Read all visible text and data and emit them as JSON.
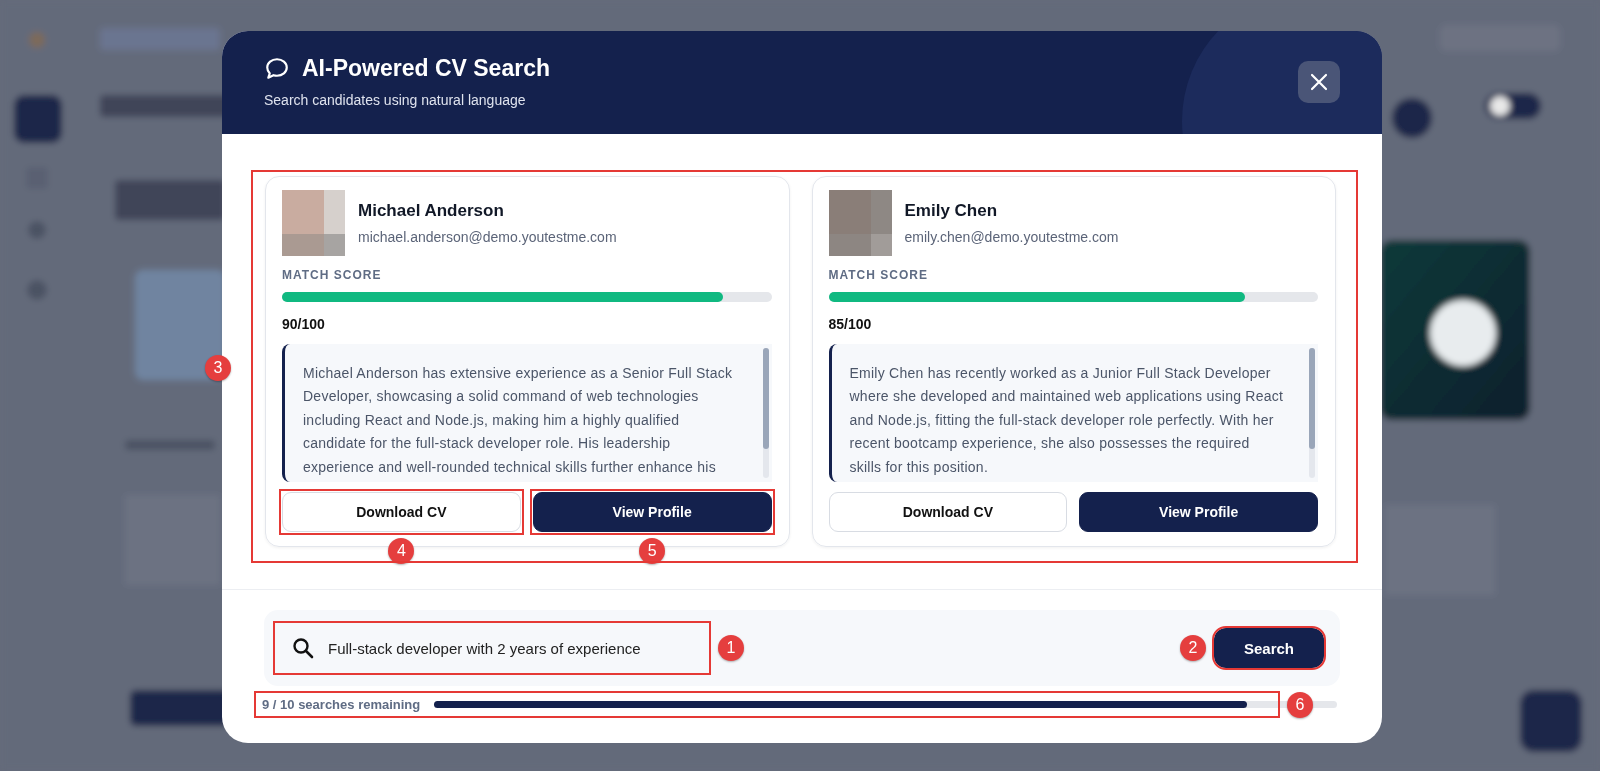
{
  "dialog": {
    "title": "AI-Powered CV Search",
    "subtitle": "Search candidates using natural language"
  },
  "results": [
    {
      "name": "Michael Anderson",
      "email": "michael.anderson@demo.youtestme.com",
      "score_label": "MATCH SCORE",
      "level": 0.9,
      "score": "90/100",
      "summary": "Michael Anderson has extensive experience as a Senior Full Stack Developer, showcasing a solid command of web technologies including React and Node.js, making him a highly qualified candidate for the full-stack developer role. His leadership experience and well-rounded technical skills further enhance his",
      "buttons": [
        {
          "label": "Download CV",
          "annotation": "4"
        },
        {
          "label": "View Profile",
          "annotation": "5"
        }
      ]
    },
    {
      "name": "Emily Chen",
      "email": "emily.chen@demo.youtestme.com",
      "score_label": "MATCH SCORE",
      "level": 0.85,
      "score": "85/100",
      "summary": "Emily Chen has recently worked as a Junior Full Stack Developer where she developed and maintained web applications using React and Node.js, fitting the full-stack developer role perfectly. With her recent bootcamp experience, she also possesses the required skills for this position.",
      "buttons": [
        {
          "label": "Download CV"
        },
        {
          "label": "View Profile"
        }
      ]
    }
  ],
  "results_annotation": "3",
  "search": {
    "value": "Full-stack developer with 2 years of experience",
    "annotation": "1",
    "button": "Search",
    "button_annotation": "2"
  },
  "quota": {
    "label": "9 / 10 searches remaining",
    "level": 0.9,
    "annotation": "6"
  }
}
